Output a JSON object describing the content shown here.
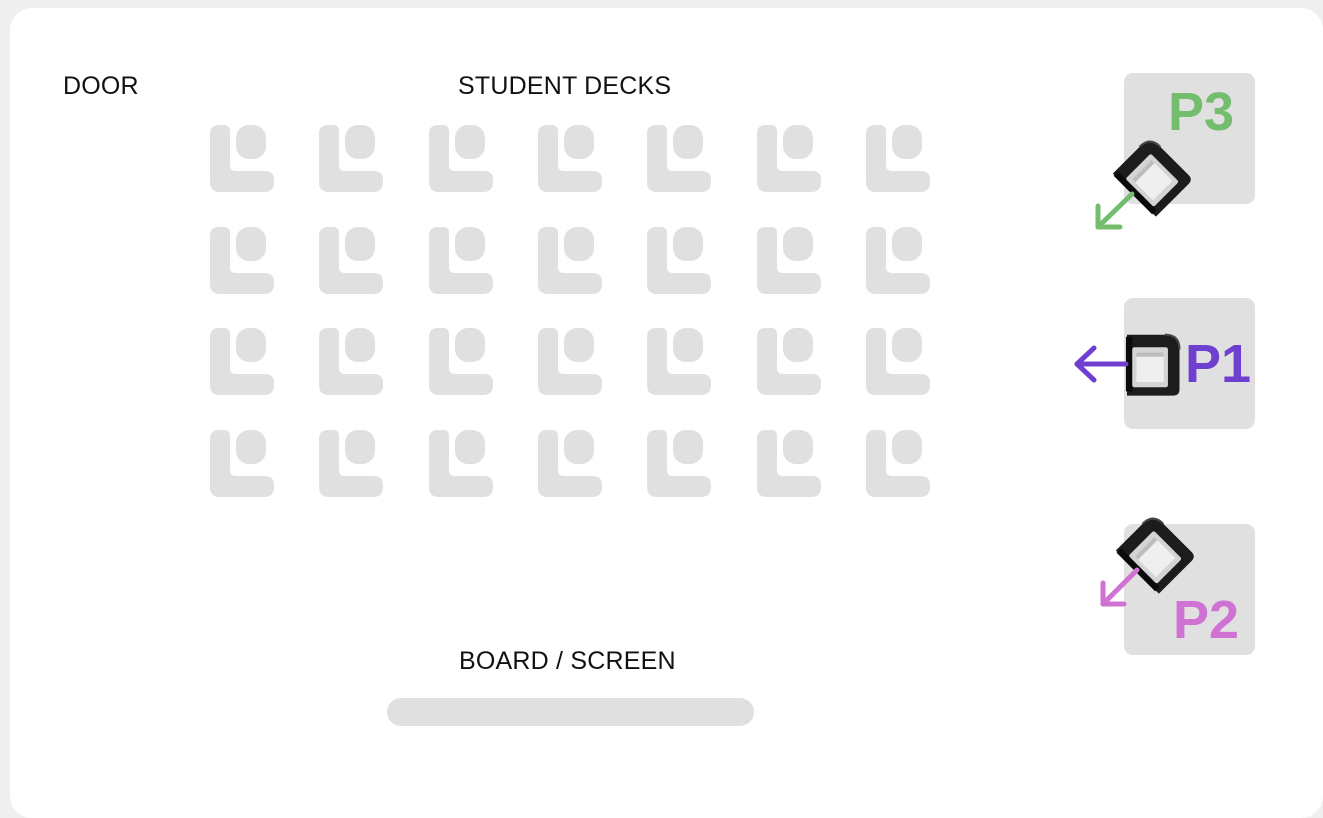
{
  "labels": {
    "door": "DOOR",
    "student_decks": "STUDENT DECKS",
    "board": "BOARD / SCREEN"
  },
  "desks": {
    "rows": 4,
    "columns": 7,
    "icon": "desk-icon",
    "color": "#e0e0e0"
  },
  "stations": [
    {
      "id": "P3",
      "label": "P3",
      "color": "#74bd6e",
      "arrow": "arrow-down-left-icon",
      "device": "projector-icon"
    },
    {
      "id": "P1",
      "label": "P1",
      "color": "#6f40cf",
      "arrow": "arrow-left-icon",
      "device": "projector-icon"
    },
    {
      "id": "P2",
      "label": "P2",
      "color": "#d072d3",
      "arrow": "arrow-down-left-icon",
      "device": "projector-icon"
    }
  ],
  "colors": {
    "background": "#efefef",
    "card": "#ffffff",
    "station_box": "#e0e0e0",
    "board": "#e0e0e0"
  }
}
